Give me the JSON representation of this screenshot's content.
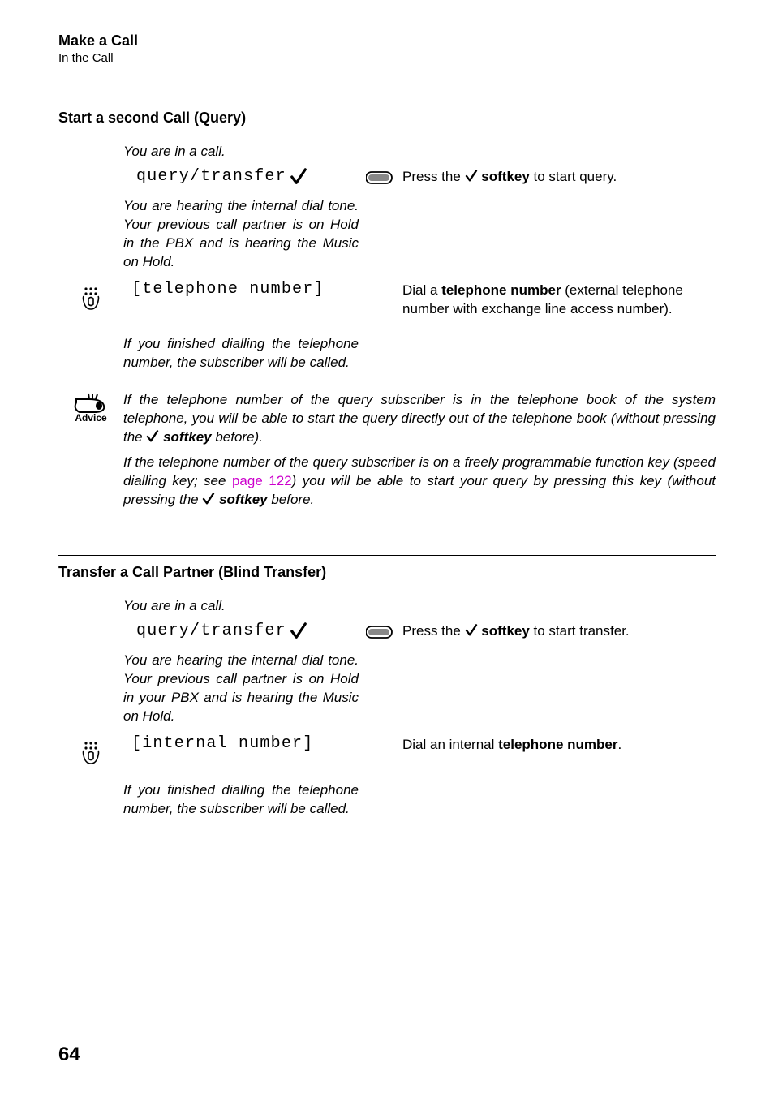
{
  "header": {
    "title": "Make a Call",
    "subtitle": "In the Call"
  },
  "section1": {
    "heading": "Start a second Call (Query)",
    "state1": "You are in a call.",
    "display1": "query/transfer",
    "press_pre": "Press the ",
    "press_strong": "softkey",
    "press_post": " to start query.",
    "state2": "You are hearing the internal dial tone. Your previous call partner is on Hold in the PBX and is hearing the Music on Hold.",
    "display2": "[telephone number]",
    "dial_pre": "Dial a ",
    "dial_strong": "telephone number",
    "dial_post": " (external telephone number with exchange line access number).",
    "state3": "If you finished dialling the telephone number, the subscriber will be called."
  },
  "advice": {
    "label": "Advice",
    "para1_a": "If the telephone number of the query subscriber is in the telephone book of the system telephone, you will be able to start the query directly out of the telephone book (without pressing the ",
    "para1_b": "softkey",
    "para1_c": " before).",
    "para2_a": "If the telephone number of the query subscriber is on a freely programmable function key (speed dialling key; see ",
    "para2_link": "page 122",
    "para2_b": ") you will be able to start your query by pressing this key (without pressing the ",
    "para2_c": "softkey",
    "para2_d": " before."
  },
  "section2": {
    "heading": "Transfer a Call Partner (Blind Transfer)",
    "state1": "You are in a call.",
    "display1": "query/transfer",
    "press_pre": "Press the ",
    "press_strong": "softkey",
    "press_post": " to start transfer.",
    "state2": "You are hearing the internal dial tone. Your previous call partner is on Hold in your PBX and is hearing the Music on Hold.",
    "display2": "[internal number]",
    "dial_pre": "Dial an internal ",
    "dial_strong": "telephone number",
    "dial_post": ".",
    "state3": "If you finished dialling the telephone number, the subscriber will be called."
  },
  "page_number": "64"
}
